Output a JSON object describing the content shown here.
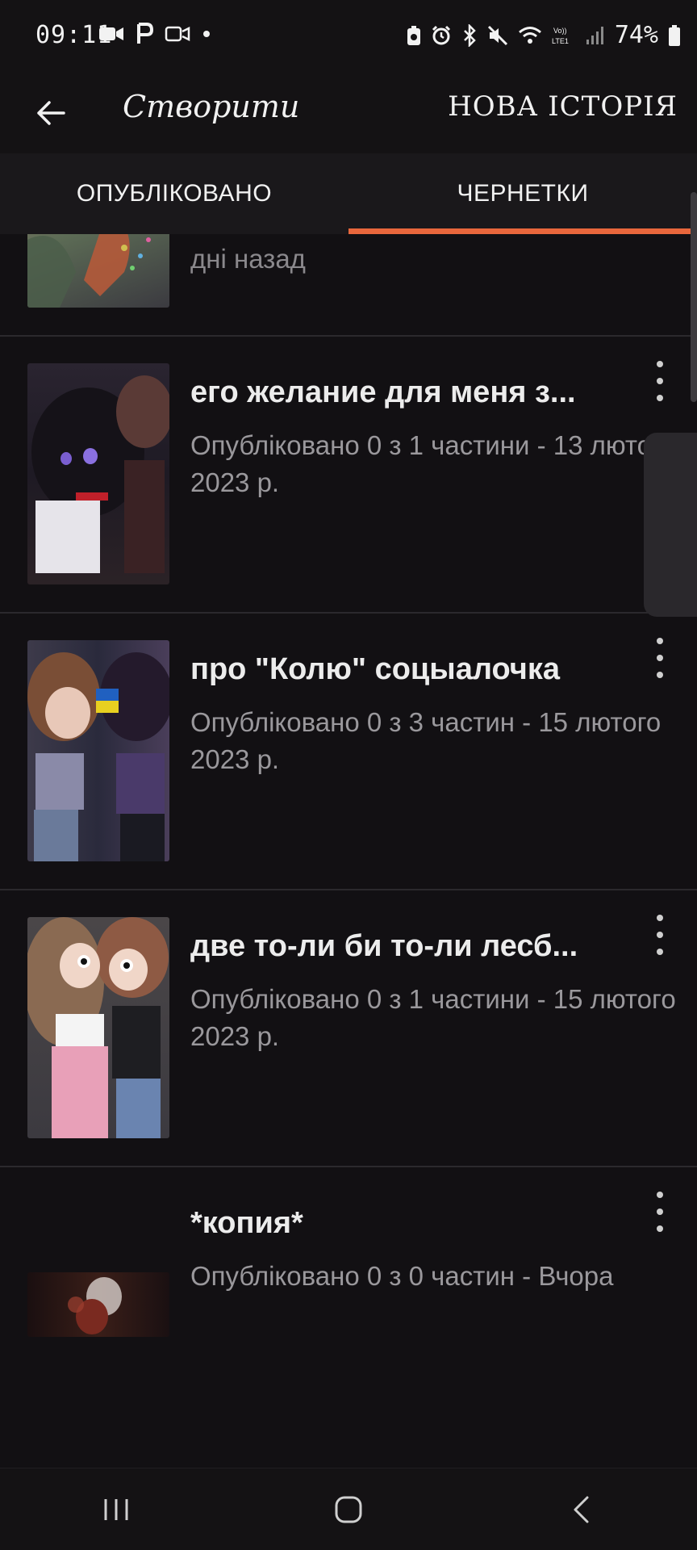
{
  "status": {
    "time": "09:11",
    "battery": "74%",
    "icons_left": [
      "video-icon",
      "p-icon",
      "camera-icon",
      "dot-icon"
    ],
    "icons_right": [
      "battery-saver-icon",
      "alarm-icon",
      "bluetooth-icon",
      "mute-icon",
      "wifi-icon",
      "volte-icon",
      "signal-icon",
      "battery-icon"
    ]
  },
  "appbar": {
    "title": "Створити",
    "new_story": "НОВА ІСТОРІЯ"
  },
  "tabs": [
    {
      "label": "ОПУБЛІКОВАНО",
      "active": false
    },
    {
      "label": "ЧЕРНЕТКИ",
      "active": true
    }
  ],
  "partial_item": {
    "meta": "дні назад"
  },
  "items": [
    {
      "title": "его желание для меня з...",
      "meta": "Опубліковано 0 з 1 частини - 13 лютого 2023 р."
    },
    {
      "title": "про \"Колю\" соцыалочка",
      "meta": "Опубліковано 0 з 3 частин - 15 лютого 2023 р."
    },
    {
      "title": "две то-ли би то-ли лесб...",
      "meta": "Опубліковано 0 з 1 частини - 15 лютого 2023 р."
    },
    {
      "title": "*копия*",
      "meta": "Опубліковано 0 з 0 частин - Вчора"
    }
  ],
  "colors": {
    "background": "#121013",
    "accent": "#e8673c",
    "text_primary": "#ececec",
    "text_secondary": "#9a989c"
  }
}
